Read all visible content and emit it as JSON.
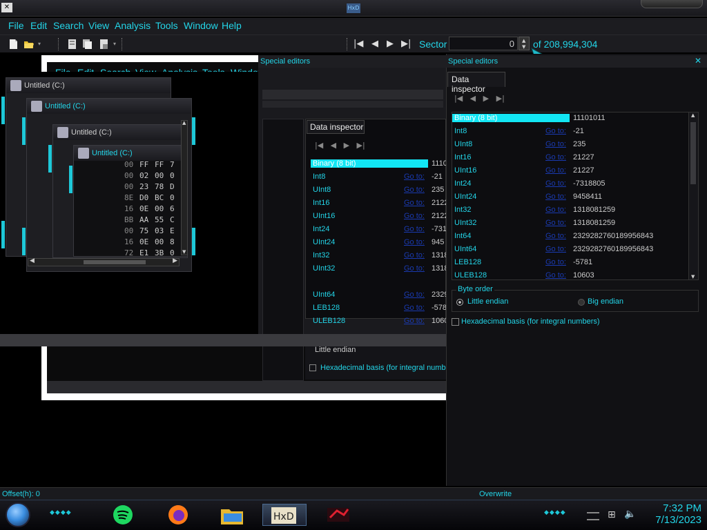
{
  "menu": [
    "File",
    "Edit",
    "Search",
    "View",
    "Analysis",
    "Tools",
    "Window",
    "Help"
  ],
  "toolbar": {
    "sector_label": "Sector",
    "sector_value": "0",
    "sector_total": "of 208,994,304"
  },
  "mdi_windows": [
    {
      "title": "Untitled (C:)"
    },
    {
      "title": "Untitled (C:)"
    },
    {
      "title": "Untitled (C:)"
    },
    {
      "title": "Untitled (C:)"
    }
  ],
  "hex_rows": [
    {
      "bytes": [
        "00",
        "FF",
        "FF",
        "7"
      ]
    },
    {
      "bytes": [
        "00",
        "02",
        "00",
        "0"
      ]
    },
    {
      "bytes": [
        "00",
        "23",
        "78",
        "D"
      ]
    },
    {
      "bytes": [
        "8E",
        "D0",
        "BC",
        "0"
      ]
    },
    {
      "bytes": [
        "16",
        "0E",
        "00",
        "6"
      ]
    },
    {
      "bytes": [
        "BB",
        "AA",
        "55",
        "C"
      ]
    },
    {
      "bytes": [
        "00",
        "75",
        "03",
        "E"
      ]
    },
    {
      "bytes": [
        "16",
        "0E",
        "00",
        "8"
      ]
    },
    {
      "bytes": [
        "72",
        "E1",
        "3B",
        "0"
      ]
    }
  ],
  "special_editors_title": "Special editors",
  "data_inspector_tab": "Data inspector",
  "inspector_rows": [
    {
      "name": "Binary (8 bit)",
      "link": "",
      "value": "11101011"
    },
    {
      "name": "Int8",
      "link": "Go to:",
      "value": "-21"
    },
    {
      "name": "UInt8",
      "link": "Go to:",
      "value": "235"
    },
    {
      "name": "Int16",
      "link": "Go to:",
      "value": "21227"
    },
    {
      "name": "UInt16",
      "link": "Go to:",
      "value": "21227"
    },
    {
      "name": "Int24",
      "link": "Go to:",
      "value": "-7318805"
    },
    {
      "name": "UInt24",
      "link": "Go to:",
      "value": "9458411"
    },
    {
      "name": "Int32",
      "link": "Go to:",
      "value": "1318081259"
    },
    {
      "name": "UInt32",
      "link": "Go to:",
      "value": "1318081259"
    },
    {
      "name": "Int64",
      "link": "Go to:",
      "value": "2329282760189956843"
    },
    {
      "name": "UInt64",
      "link": "Go to:",
      "value": "2329282760189956843"
    },
    {
      "name": "LEB128",
      "link": "Go to:",
      "value": "-5781"
    },
    {
      "name": "ULEB128",
      "link": "Go to:",
      "value": "10603"
    }
  ],
  "center_inspector_rows": [
    {
      "name": "Binary (8 bit)",
      "link": "",
      "value": "1110"
    },
    {
      "name": "Int8",
      "link": "Go to:",
      "value": "-21"
    },
    {
      "name": "UInt8",
      "link": "Go to:",
      "value": "235"
    },
    {
      "name": "Int16",
      "link": "Go to:",
      "value": "2122"
    },
    {
      "name": "UInt16",
      "link": "Go to:",
      "value": "2122"
    },
    {
      "name": "Int24",
      "link": "Go to:",
      "value": "-731"
    },
    {
      "name": "UInt24",
      "link": "Go to:",
      "value": "945"
    },
    {
      "name": "Int32",
      "link": "Go to:",
      "value": "1318"
    },
    {
      "name": "UInt32",
      "link": "Go to:",
      "value": "1318"
    },
    {
      "name": "UInt64",
      "link": "Go to:",
      "value": "2329"
    },
    {
      "name": "LEB128",
      "link": "Go to:",
      "value": "-578"
    },
    {
      "name": "ULEB128",
      "link": "Go to:",
      "value": "1060"
    }
  ],
  "byte_order": {
    "label": "Byte order",
    "little": "Little endian",
    "big": "Big endian",
    "selected": "little"
  },
  "hex_basis_label": "Hexadecimal basis (for integral numbers)",
  "center_hex_basis_label": "Hexadecimal basis (for integral numb",
  "center_little_endian": "Little endian",
  "status": {
    "offset": "Offset(h): 0",
    "mode": "Overwrite"
  },
  "clock": {
    "time": "7:32 PM",
    "date": "7/13/2023"
  },
  "colors": {
    "accent": "#23d5e8",
    "selection": "#12e6f4",
    "link": "#1a3ab0"
  }
}
